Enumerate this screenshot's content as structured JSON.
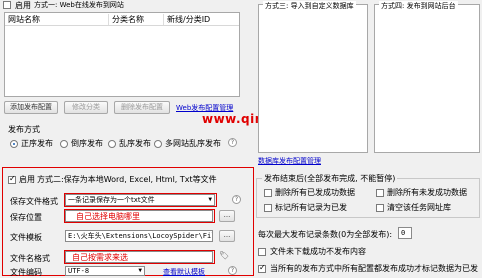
{
  "top_left": {
    "enable_label": "启用",
    "method_title": "方式一: Web在线发布到网站",
    "columns": [
      "网站名称",
      "分类名称",
      "新线/分类ID"
    ],
    "add_button": "添加发布配置",
    "edit_button": "修改分类",
    "delete_button": "删除发布配置",
    "manage_link": "Web发布配置管理"
  },
  "publish_mode": {
    "label": "发布方式",
    "options": [
      "正序发布",
      "倒序发布",
      "乱序发布",
      "多网站乱序发布"
    ]
  },
  "watermark": "www.qinjinchang.com",
  "panel_three": {
    "title": "方式三: 导入到自定义数据库"
  },
  "panel_four": {
    "title": "方式四: 发布到网站后台"
  },
  "db_link": "数据库发布配置管理",
  "method_two": {
    "enable_label": "启用",
    "title": "方式二:保存为本地Word, Excel, Html, Txt等文件",
    "format_label": "保存文件格式",
    "format_value": "一条记录保存为一个txt文件",
    "location_label": "保存位置",
    "location_annotation": "自己选择电脑哪里",
    "template_label": "文件模板",
    "template_value": "E:\\火车头\\Extensions\\LocoySpider\\File",
    "filename_label": "文件名格式",
    "filename_annotation": "自己按需求来选",
    "encoding_label": "文件编码",
    "encoding_value": "UTF-8",
    "default_template_link": "查看默认模板",
    "browse": "..."
  },
  "after_publish": {
    "title": "发布结束后(全部发布完成, 不能暂停)",
    "opt1": "删除所有已发成功数据",
    "opt2": "删除所有未发成功数据",
    "opt3": "标记所有记录为已发",
    "opt4": "清空该任务网址库"
  },
  "max_count": {
    "label": "每次最大发布记录条数(0为全部发布):",
    "value": "0"
  },
  "skip_unsaved": "文件未下载成功不发布内容",
  "mark_published": "当所有的发布方式中所有配置都发布成功才标记数据为已发"
}
